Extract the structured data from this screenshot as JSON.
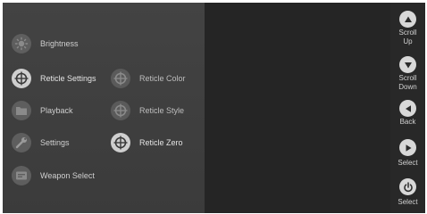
{
  "menu": {
    "items": [
      {
        "label": "Brightness",
        "icon": "brightness-icon"
      },
      {
        "label": "Reticle Settings",
        "icon": "reticle-icon"
      },
      {
        "label": "Reticle Color",
        "icon": "reticle-icon"
      },
      {
        "label": "Playback",
        "icon": "folder-icon"
      },
      {
        "label": "Reticle Style",
        "icon": "reticle-icon"
      },
      {
        "label": "Settings",
        "icon": "wrench-icon"
      },
      {
        "label": "Reticle Zero",
        "icon": "reticle-icon"
      },
      {
        "label": "Weapon Select",
        "icon": "weapon-icon"
      }
    ]
  },
  "sidebar": {
    "buttons": [
      {
        "label": "Scroll Up",
        "icon": "triangle-up-icon"
      },
      {
        "label": "Scroll Down",
        "icon": "triangle-down-icon"
      },
      {
        "label": "Back",
        "icon": "triangle-left-icon"
      },
      {
        "label": "Select",
        "icon": "triangle-right-icon"
      },
      {
        "label": "Select",
        "icon": "power-icon"
      }
    ]
  },
  "colors": {
    "panel": "#3f3f3f",
    "view": "#252525",
    "icon_lit": "#cfcfcf",
    "icon_dim": "#5e5e5e",
    "text": "#e4e4e4"
  }
}
